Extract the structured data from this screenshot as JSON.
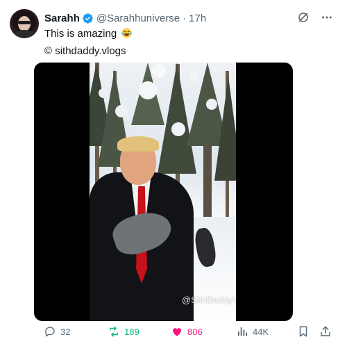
{
  "author": {
    "display_name": "Sarahh",
    "handle": "@Sarahhuniverse",
    "separator": "·",
    "time": "17h"
  },
  "tweet": {
    "text": "This is amazing",
    "emoji": "face-with-tears-of-joy",
    "credit": "© sithdaddy.vlogs"
  },
  "media": {
    "watermark": "@SithDaddyVlogs"
  },
  "actions": {
    "replies": "32",
    "reposts": "189",
    "likes": "806",
    "views": "44K"
  },
  "colors": {
    "verified": "#1d9bf0",
    "repost": "#00ba7c",
    "like": "#f91880",
    "muted": "#536471"
  }
}
